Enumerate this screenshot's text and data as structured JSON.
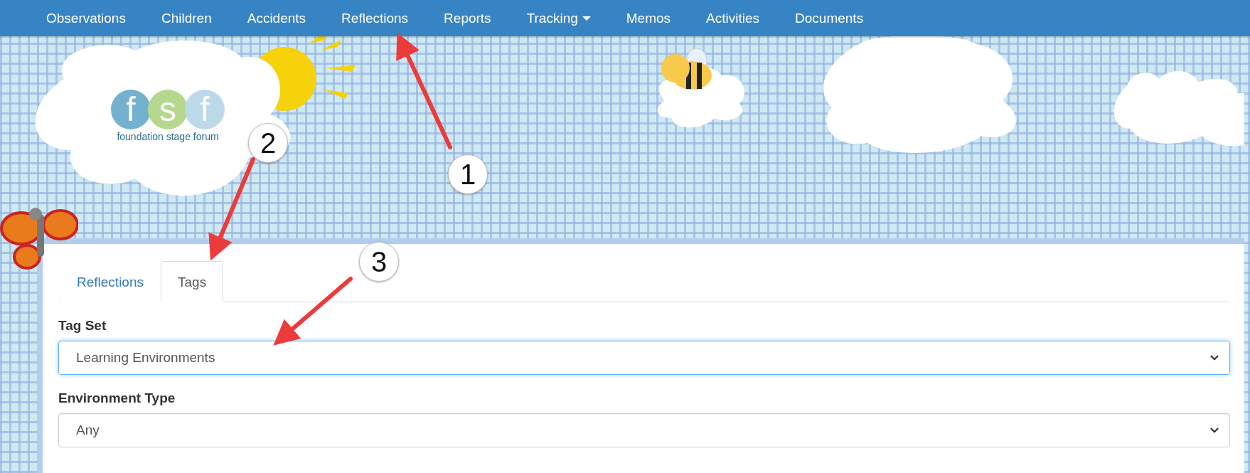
{
  "nav": {
    "items": [
      {
        "label": "Observations",
        "dropdown": false
      },
      {
        "label": "Children",
        "dropdown": false
      },
      {
        "label": "Accidents",
        "dropdown": false
      },
      {
        "label": "Reflections",
        "dropdown": false
      },
      {
        "label": "Reports",
        "dropdown": false
      },
      {
        "label": "Tracking",
        "dropdown": true
      },
      {
        "label": "Memos",
        "dropdown": false
      },
      {
        "label": "Activities",
        "dropdown": false
      },
      {
        "label": "Documents",
        "dropdown": false
      }
    ]
  },
  "logo": {
    "letters": [
      "f",
      "s",
      "f"
    ],
    "tagline": "foundation stage forum"
  },
  "tabs": [
    {
      "label": "Reflections",
      "selected": false
    },
    {
      "label": "Tags",
      "selected": true
    }
  ],
  "fields": [
    {
      "label": "Tag Set",
      "value": "Learning Environments",
      "focused": true
    },
    {
      "label": "Environment Type",
      "value": "Any",
      "focused": false
    }
  ],
  "callouts": [
    "1",
    "2",
    "3"
  ]
}
